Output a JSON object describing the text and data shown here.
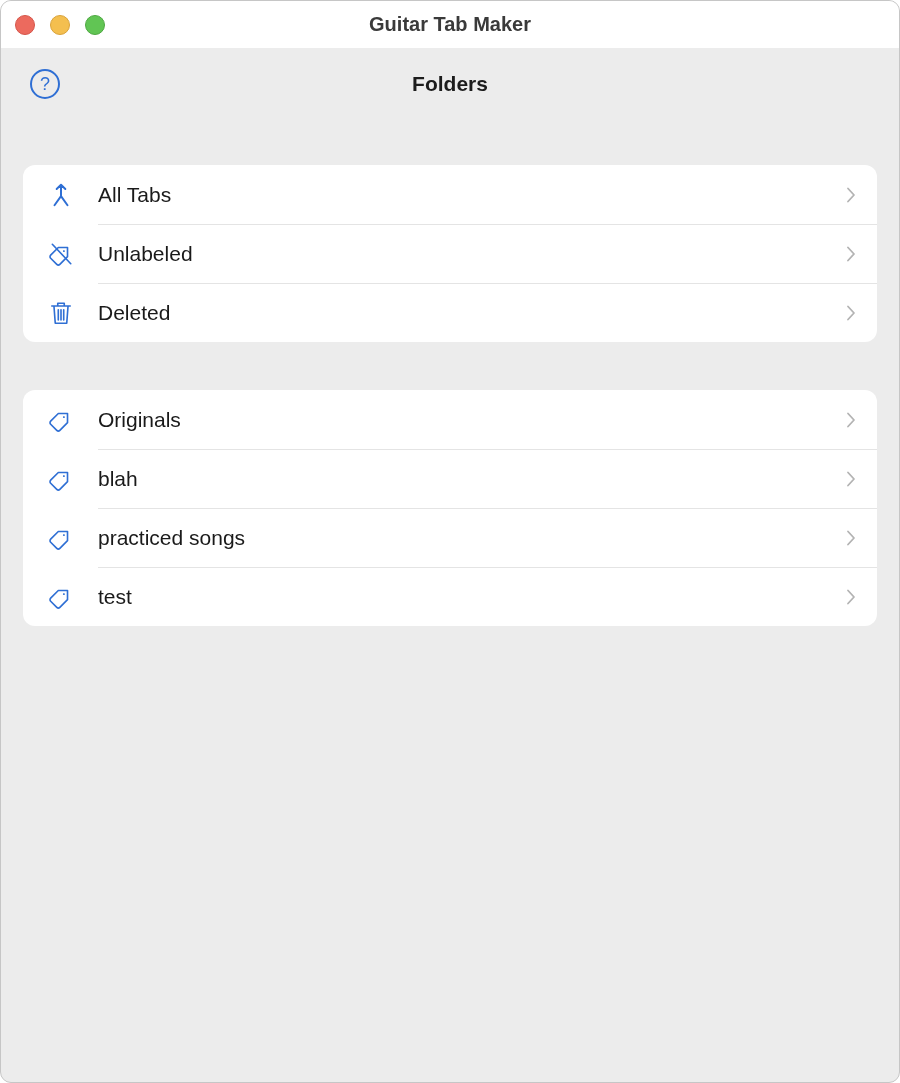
{
  "window": {
    "title": "Guitar Tab Maker"
  },
  "toolbar": {
    "help_button": "?",
    "title": "Folders"
  },
  "smart_folders": [
    {
      "kind": "all",
      "label": "All Tabs"
    },
    {
      "kind": "unlabeled",
      "label": "Unlabeled"
    },
    {
      "kind": "deleted",
      "label": "Deleted"
    }
  ],
  "label_folders": [
    {
      "label": "Originals"
    },
    {
      "label": "blah"
    },
    {
      "label": "practiced songs"
    },
    {
      "label": "test"
    }
  ]
}
